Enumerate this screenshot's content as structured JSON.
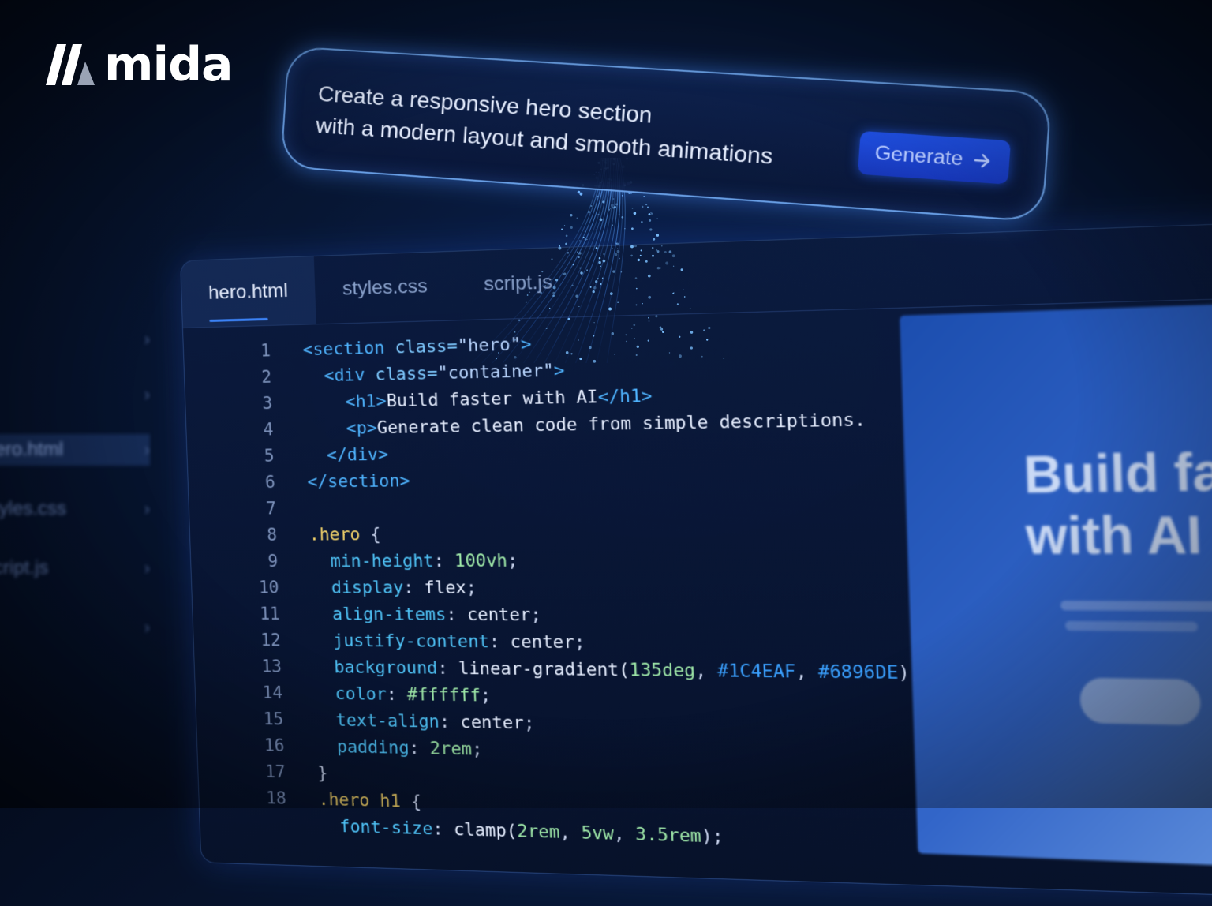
{
  "brand": {
    "name": "mida"
  },
  "prompt": {
    "line1": "Create a responsive hero section",
    "line2": "with a modern layout and smooth animations",
    "button_label": "Generate",
    "button_icon": "arrow-right-icon"
  },
  "editor": {
    "tabs": [
      {
        "label": "hero.html",
        "active": true
      },
      {
        "label": "styles.css",
        "active": false
      },
      {
        "label": "script.js",
        "active": false
      }
    ],
    "line_numbers": [
      "1",
      "2",
      "3",
      "4",
      "5",
      "6",
      "7",
      "8",
      "9",
      "10",
      "11",
      "12",
      "13",
      "14",
      "15",
      "16",
      "17",
      "18"
    ],
    "code": {
      "l1_tag_open": "<section",
      "l1_attr": " class=",
      "l1_val": "\"hero\"",
      "l1_close": ">",
      "l2_tag_open": "<div",
      "l2_attr": " class=",
      "l2_val": "\"container\"",
      "l2_close": ">",
      "l3_open": "<h1>",
      "l3_text": "Build faster with AI",
      "l3_close": "</h1>",
      "l4_open": "<p>",
      "l4_text": "Generate clean code from simple descriptions.",
      "l5": "</div>",
      "l6": "</section>",
      "l8_sel": ".hero",
      "l8_brace": " {",
      "l9_prop": "min-height",
      "l9_val": "100vh",
      "l10_prop": "display",
      "l10_val": "flex",
      "l11_prop": "align-items",
      "l11_val": "center",
      "l12_prop": "justify-content",
      "l12_val": "center",
      "l13_prop": "background",
      "l13_fn": "linear-gradient(",
      "l13_num": "135deg",
      "l13_hex1": "#1C4EAF",
      "l13_hex2": "#6896DE",
      "l13_end": ");",
      "l14_prop": "color",
      "l14_val": "#ffffff",
      "l15_prop": "text-align",
      "l15_val": "center",
      "l16_prop": "padding",
      "l16_val": "2rem",
      "l17": "}",
      "l18_sel": ".hero h1",
      "l18_brace": " {",
      "l19_prop": "font-size",
      "l19_fn": "clamp(",
      "l19_a": "2rem",
      "l19_b": "5vw",
      "l19_c": "3.5rem",
      "l19_end": ");"
    }
  },
  "preview": {
    "title": "Build faster with AI"
  },
  "sidebar": {
    "items": [
      "hero.html",
      "styles.css",
      "script.js"
    ]
  },
  "colors": {
    "accent": "#3b82f6",
    "gradient_start": "#1C4EAF",
    "gradient_end": "#6896DE"
  }
}
